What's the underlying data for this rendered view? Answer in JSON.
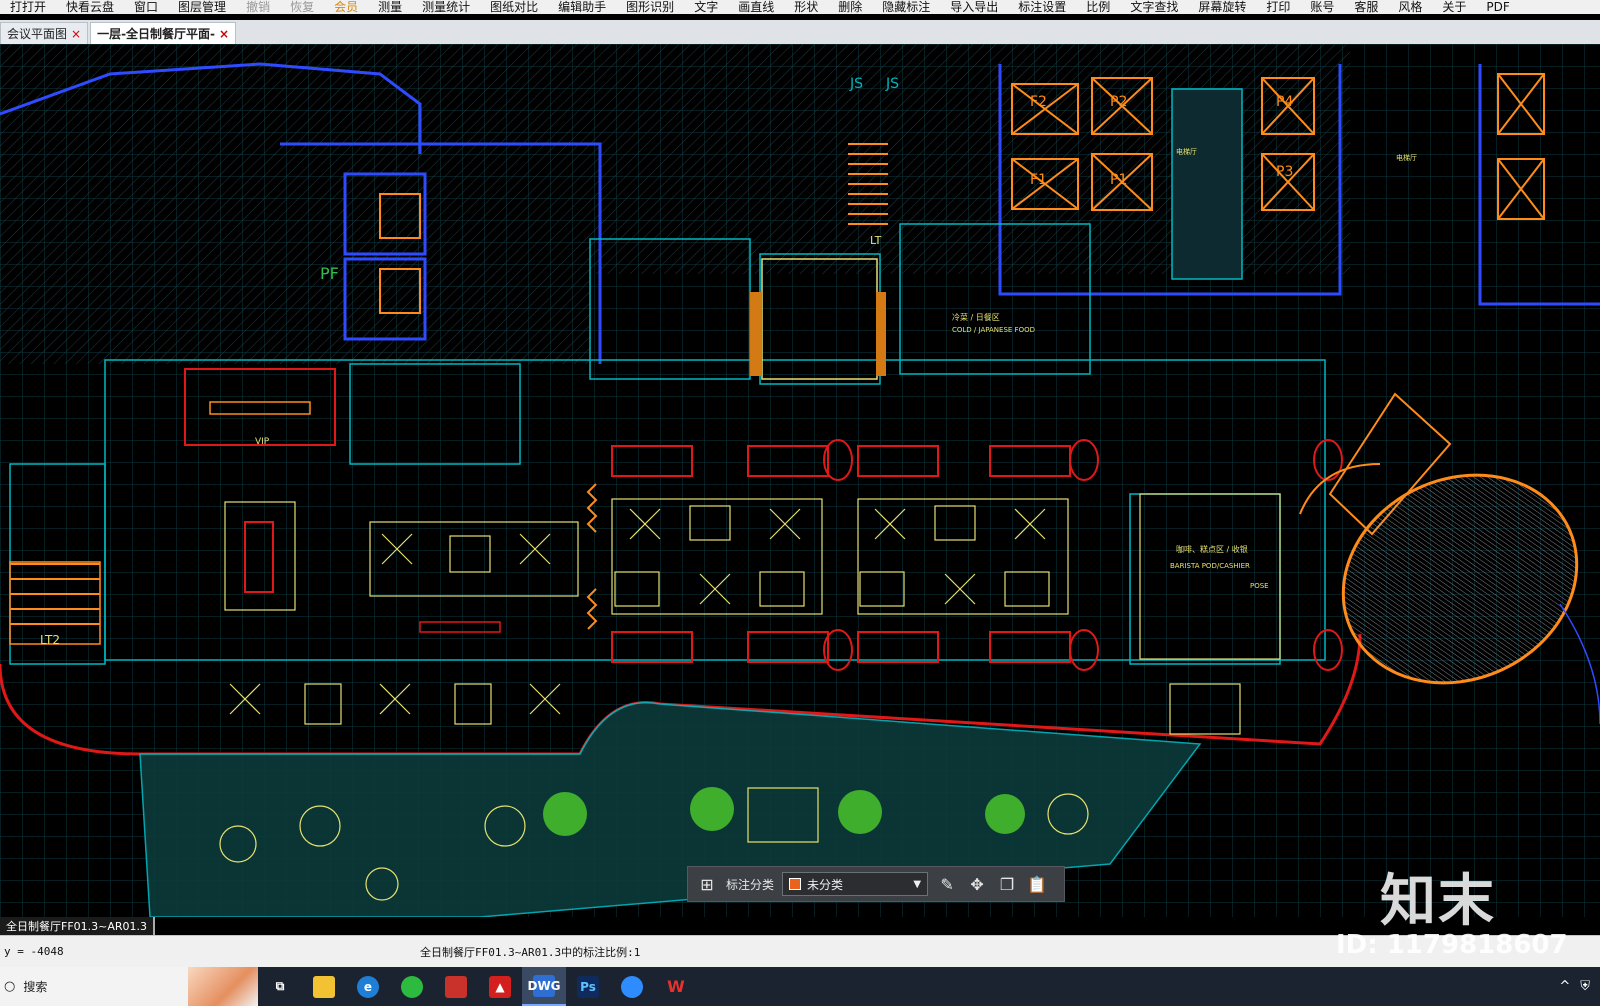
{
  "menu": {
    "items": [
      {
        "label": "打打开",
        "state": "normal"
      },
      {
        "label": "快看云盘",
        "state": "normal"
      },
      {
        "label": "窗口",
        "state": "normal"
      },
      {
        "label": "图层管理",
        "state": "normal"
      },
      {
        "label": "撤销",
        "state": "disabled"
      },
      {
        "label": "恢复",
        "state": "disabled"
      },
      {
        "label": "会员",
        "state": "accent"
      },
      {
        "label": "测量",
        "state": "normal"
      },
      {
        "label": "测量统计",
        "state": "normal"
      },
      {
        "label": "图纸对比",
        "state": "normal"
      },
      {
        "label": "编辑助手",
        "state": "normal"
      },
      {
        "label": "图形识别",
        "state": "normal"
      },
      {
        "label": "文字",
        "state": "normal"
      },
      {
        "label": "画直线",
        "state": "normal"
      },
      {
        "label": "形状",
        "state": "normal"
      },
      {
        "label": "删除",
        "state": "normal"
      },
      {
        "label": "隐藏标注",
        "state": "normal"
      },
      {
        "label": "导入导出",
        "state": "normal"
      },
      {
        "label": "标注设置",
        "state": "normal"
      },
      {
        "label": "比例",
        "state": "normal"
      },
      {
        "label": "文字查找",
        "state": "normal"
      },
      {
        "label": "屏幕旋转",
        "state": "normal"
      },
      {
        "label": "打印",
        "state": "normal"
      },
      {
        "label": "账号",
        "state": "normal"
      },
      {
        "label": "客服",
        "state": "normal"
      },
      {
        "label": "风格",
        "state": "normal"
      },
      {
        "label": "关于",
        "state": "normal"
      },
      {
        "label": "PDF",
        "state": "normal"
      }
    ]
  },
  "tabs": [
    {
      "label": "会议平面图",
      "close": "×",
      "active": false
    },
    {
      "label": "一层-全日制餐厅平面-",
      "close": "×",
      "active": true
    }
  ],
  "drawing": {
    "labels": {
      "vip": "VIP",
      "lt2": "LT2",
      "pf": "PF",
      "f2": "F2",
      "p2": "P2",
      "f1": "F1",
      "p1": "P1",
      "p4": "P4",
      "p3": "P3",
      "js1": "JS",
      "js2": "JS",
      "cold_jp": "COLD / JAPANESE FOOD",
      "cold_jp_cn": "冷菜 / 日餐区",
      "barista": "BARISTA POD/CASHIER",
      "barista_cn": "咖啡、糕点区 / 收银",
      "pose": "POSE",
      "lt": "LT",
      "elevator_hall": "电梯厅",
      "elevator_hall2": "电梯厅"
    }
  },
  "annotation_toolbar": {
    "label": "标注分类",
    "category_value": "未分类",
    "swatch_color": "#e8641e",
    "icons": [
      "grid-icon",
      "edit-icon",
      "move-icon",
      "copy-icon",
      "paste-icon"
    ]
  },
  "layout_tab": {
    "label": "全日制餐厅FF01.3~AR01.3"
  },
  "status": {
    "coords": "y = -4048",
    "scale_text": "全日制餐厅FF01.3~AR01.3中的标注比例:1"
  },
  "taskbar": {
    "search_label": "搜索",
    "apps": [
      "task-view",
      "file-explorer",
      "edge",
      "wechat",
      "app-red",
      "acrobat",
      "cad-viewer",
      "photoshop",
      "baidu-netdisk",
      "wps"
    ]
  },
  "watermark": {
    "logo": "知末",
    "id_text": "ID: 1179818607"
  },
  "colors": {
    "canvas_bg": "#000000",
    "cad_cyan": "#00b7c3",
    "cad_yellow": "#e6e070",
    "cad_orange": "#ff8c1a",
    "cad_red": "#e01818",
    "cad_blue": "#2f4bff"
  }
}
